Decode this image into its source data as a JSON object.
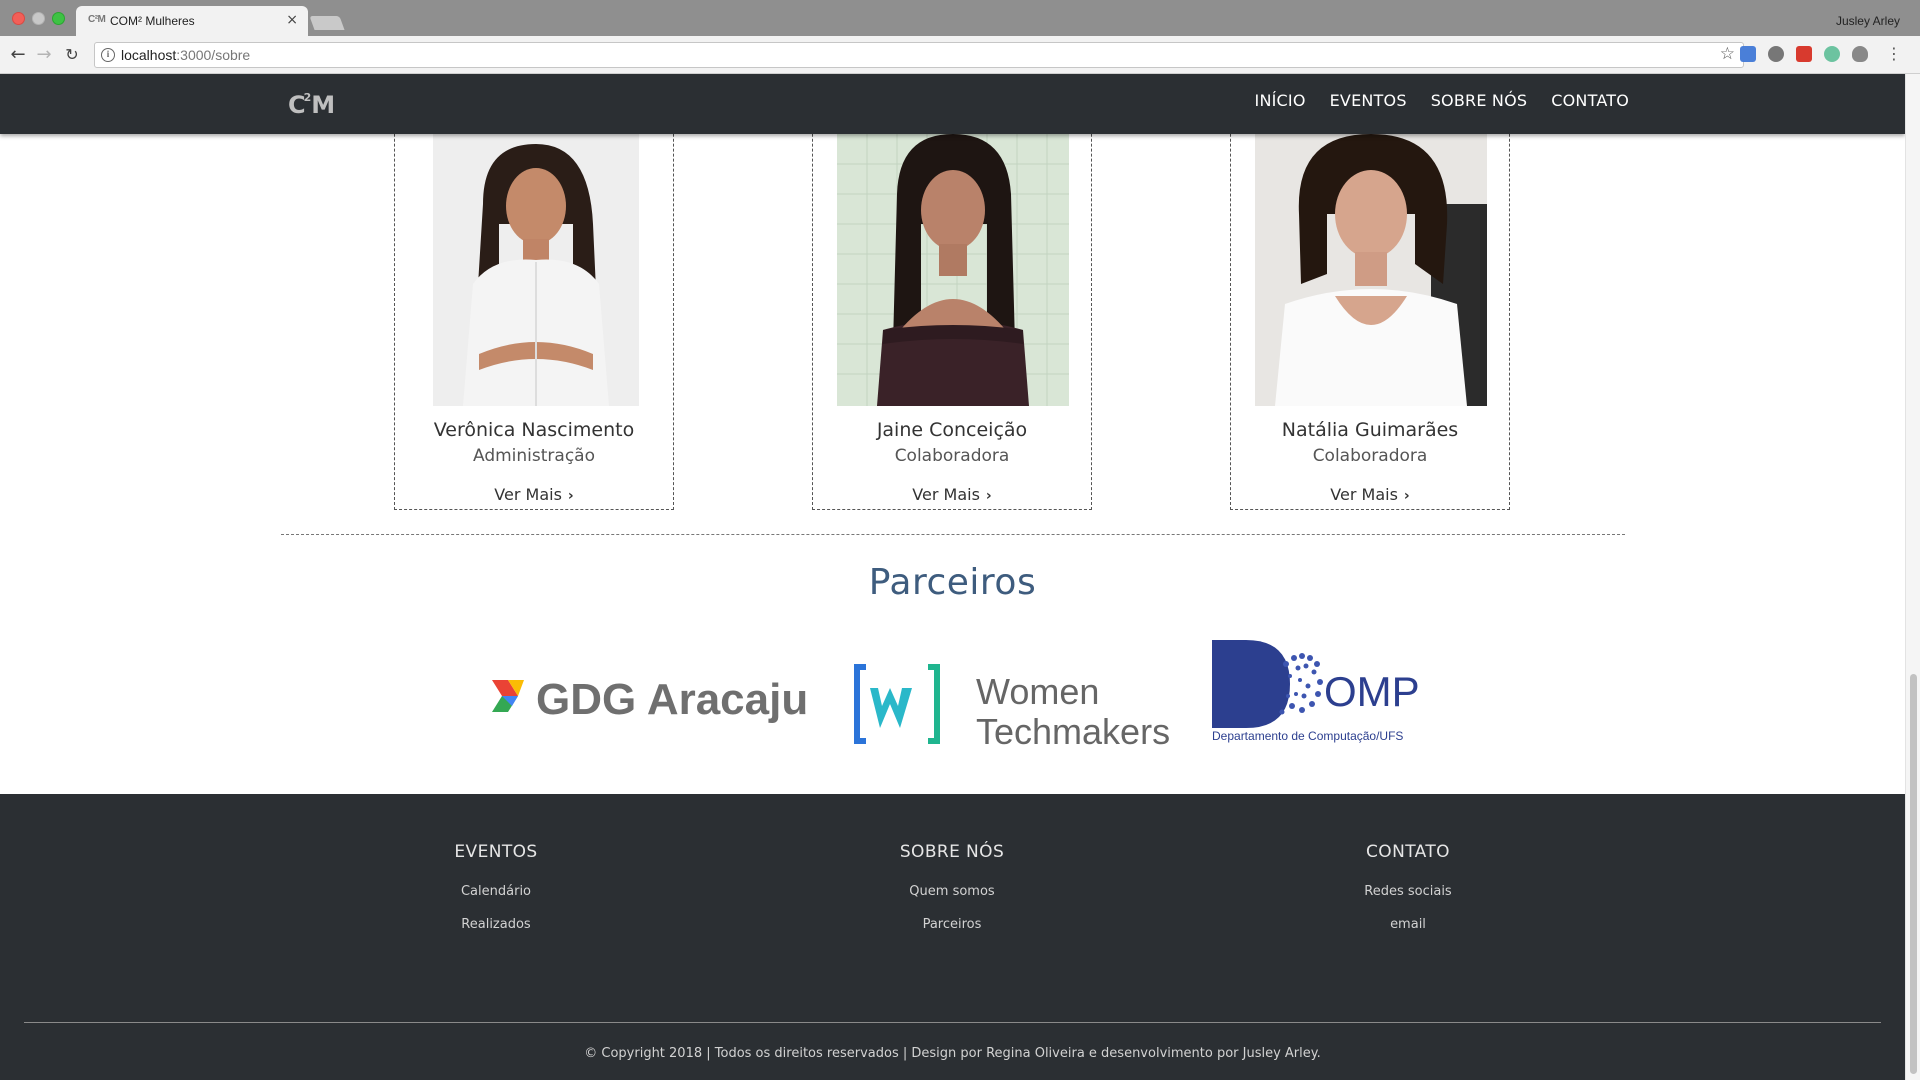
{
  "browser": {
    "tab_title": "COM² Mulheres",
    "tab_favicon": "C²M",
    "tab_close": "×",
    "profile_name": "Jusley Arley",
    "url_host": "localhost",
    "url_path": ":3000/sobre",
    "info_glyph": "i",
    "star_glyph": "☆",
    "back_glyph": "←",
    "forward_glyph": "→",
    "reload_glyph": "↻",
    "menu_glyph": "⋮"
  },
  "site": {
    "brand": "C",
    "brand_sup": "2",
    "brand_tail": "M",
    "nav": [
      "INÍCIO",
      "EVENTOS",
      "SOBRE NÓS",
      "CONTATO"
    ]
  },
  "members": [
    {
      "name": "Verônica Nascimento",
      "role": "Administração",
      "more": "Ver Mais"
    },
    {
      "name": "Jaine Conceição",
      "role": "Colaboradora",
      "more": "Ver Mais"
    },
    {
      "name": "Natália Guimarães",
      "role": "Colaboradora",
      "more": "Ver Mais"
    }
  ],
  "partners": {
    "title": "Parceiros",
    "gdg": "GDG Aracaju",
    "wtm_line1": "Women",
    "wtm_line2": "Techmakers",
    "dcomp_main": "OMP",
    "dcomp_sub": "Departamento de Computação/UFS"
  },
  "footer": {
    "columns": [
      {
        "heading": "EVENTOS",
        "links": [
          "Calendário",
          "Realizados"
        ]
      },
      {
        "heading": "SOBRE NÓS",
        "links": [
          "Quem somos",
          "Parceiros"
        ]
      },
      {
        "heading": "CONTATO",
        "links": [
          "Redes sociais",
          "email"
        ]
      }
    ],
    "copyright": "© Copyright 2018 | Todos os direitos reservados | Design por Regina Oliveira e desenvolvimento por Jusley Arley."
  },
  "colors": {
    "nav_bg": "#2b2f33",
    "partners_title": "#3e5c7e",
    "footer_bg": "#2b2f33"
  }
}
